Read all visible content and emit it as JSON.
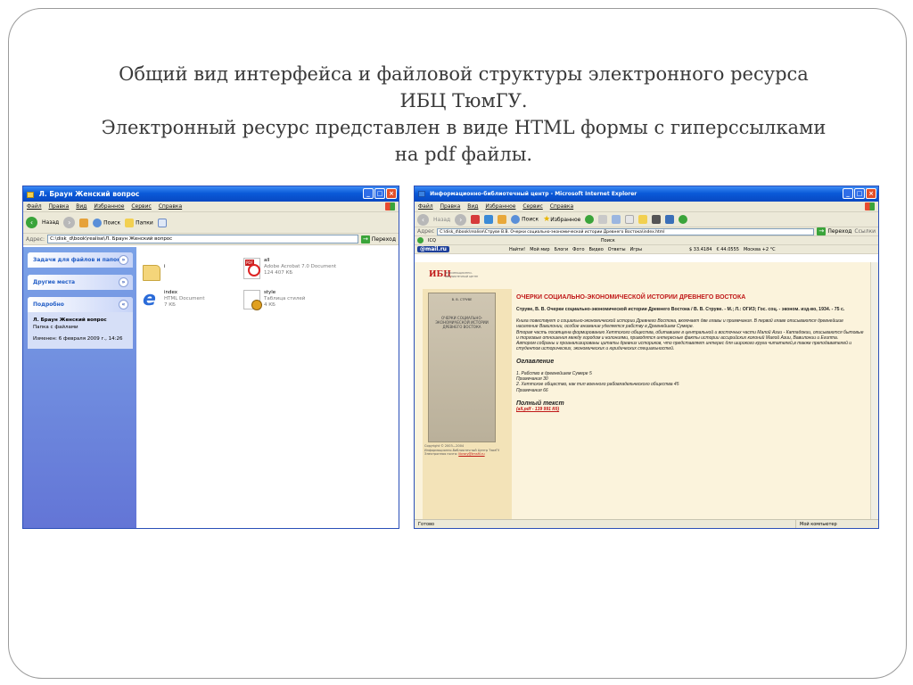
{
  "slide": {
    "title_lines": [
      "Общий вид интерфейса и файловой структуры электронного ресурса",
      "ИБЦ ТюмГУ.",
      "Электронный ресурс представлен в виде HTML формы с гиперссылками",
      "на pdf файлы."
    ]
  },
  "explorer": {
    "title": "Л. Браун Женский вопрос",
    "menu": [
      "Файл",
      "Правка",
      "Вид",
      "Избранное",
      "Сервис",
      "Справка"
    ],
    "toolbar": {
      "back": "Назад",
      "search": "Поиск",
      "folders": "Папки"
    },
    "address_label": "Адрес:",
    "address_value": "C:\\disk_d\\book\\realise\\Л. Браун Женский вопрос",
    "go_label": "Переход",
    "taskpane": {
      "tasks": "Задачи для файлов и папок",
      "places": "Другие места",
      "details": "Подробно",
      "details_name": "Л. Браун Женский вопрос",
      "details_type": "Папка с файлами",
      "details_modified": "Изменен: 6 февраля 2009 г., 14:26"
    },
    "files": [
      {
        "name": "i",
        "type": "",
        "size": "",
        "icon": "folder-icon"
      },
      {
        "name": "all",
        "type": "Adobe Acrobat 7.0 Document",
        "size": "124 407 КБ",
        "icon": "pdf-icon"
      },
      {
        "name": "index",
        "type": "HTML Document",
        "size": "7 КБ",
        "icon": "html-icon"
      },
      {
        "name": "style",
        "type": "Таблица стилей",
        "size": "4 КБ",
        "icon": "css-icon"
      }
    ]
  },
  "ie": {
    "title": "Информационно-библиотечный центр - Microsoft Internet Explorer",
    "menu": [
      "Файл",
      "Правка",
      "Вид",
      "Избранное",
      "Сервис",
      "Справка"
    ],
    "toolbar": {
      "back": "Назад",
      "search": "Поиск",
      "favorites": "Избранное"
    },
    "address_label": "Адрес",
    "address_value": "C:\\disk_d\\book\\realise\\Струве В.В. Очерки социально-экономической истории Древнего Востока\\index.html",
    "go_label": "Переход",
    "links_label": "Ссылки",
    "icq_label": "ICQ",
    "search_label": "Поиск",
    "mailru_bar": {
      "logo": "@mail.ru",
      "find": "Найти!",
      "items": [
        "Мой мир",
        "Блоги",
        "Фото",
        "Видео",
        "Ответы",
        "Игры"
      ],
      "usd": "$ 33.4184",
      "eur": "€ 44.0555",
      "weather": "Москва +2 °C"
    },
    "page": {
      "logo": "ИБЦ",
      "logo_sub": "ИНФОРМАЦИОННО-БИБЛИОТЕЧНЫЙ ЦЕНТР",
      "book_author": "В. В. СТРУВЕ",
      "book_title": "ОЧЕРКИ СОЦИАЛЬНО-ЭКОНОМИЧЕСКОЙ ИСТОРИИ ДРЕВНЕГО ВОСТОКА",
      "copyright_1": "Copyright © 2003—2004",
      "copyright_2": "Информационно-библиотечный Центр ТюмГУ",
      "copyright_3": "Электронная почта:",
      "copyright_email": "library@tmsfil.ru",
      "heading": "ОЧЕРКИ СОЦИАЛЬНО-ЭКОНОМИЧЕСКОЙ ИСТОРИИ ДРЕВНЕГО ВОСТОКА",
      "bib": "Струве, В. В. Очерки социально-экономической истории Древнего Востока / В. В. Струве. - М.; Л.: ОГИЗ; Гос. соц. - эконом. изд-во, 1934. - 75 с.",
      "desc_1": "Книга повествует о социально-экономической истории Древнего Востока, включает две главы и примечания. В первой главе описываются древнейшие население Вавилонии, особое внимание уделяется рабству в Древнейшем Сумере.",
      "desc_2": "Вторая часть посвящена формированию Хеттского общества, обитавшее в центральной и восточных части Малой Азии - Каппадокии, описываются бытовые и торговые отношения между городом и колониями, приводятся интересные факты истории ассирийских колоний Малой Азии, Вавилонии и Египта.",
      "desc_3": "Автором собраны и проанализированы цитаты древних историков, что представляет интерес для широкого круга читателей,в также преподавателей и студентов исторических, экономических и юридических специальностей.",
      "toc_heading": "Оглавление",
      "toc_1": "1. Рабство в древнейшем Сумере 5",
      "toc_1_note": "Примечания 30",
      "toc_2": "2. Хеттское общество, как тип военного рабовладельческого общества 45",
      "toc_2_note": "Примечания 66",
      "full_text": "Полный текст",
      "full_text_link": "(all.pdf - 139 991 Кб)"
    },
    "status_left": "Готово",
    "status_zone": "Мой компьютер"
  }
}
